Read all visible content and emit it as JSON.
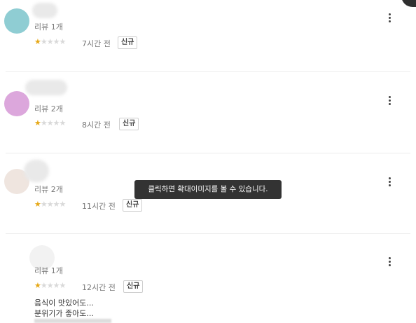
{
  "reviews": [
    {
      "avatar_color": "#8fcdd3",
      "review_count": "리뷰 1개",
      "rating": 1,
      "max_rating": 5,
      "time": "7시간 전",
      "badge": "신규"
    },
    {
      "avatar_color": "#dca7dc",
      "review_count": "리뷰 2개",
      "rating": 1,
      "max_rating": 5,
      "time": "8시간 전",
      "badge": "신규"
    },
    {
      "avatar_color": "#efe5df",
      "review_count": "리뷰 2개",
      "rating": 1,
      "max_rating": 5,
      "time": "11시간 전",
      "badge": "신규"
    },
    {
      "avatar_color": "#f2f2f2",
      "review_count": "리뷰 1개",
      "rating": 1,
      "max_rating": 5,
      "time": "12시간 전",
      "badge": "신규",
      "text_lines": [
        "음식이 맛있어도...",
        "분위기가 좋아도..."
      ]
    }
  ],
  "tooltip": "클릭하면 확대이미지를 볼 수 있습니다.",
  "icons": {
    "more": "more-vertical-icon",
    "star": "star-icon"
  }
}
